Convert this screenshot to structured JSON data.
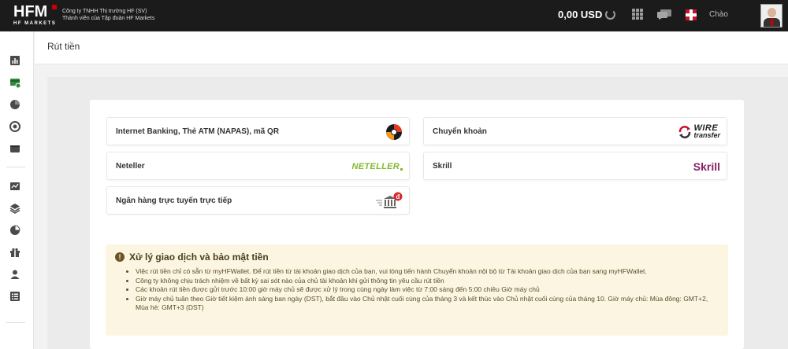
{
  "header": {
    "logo_text": "HFM",
    "logo_sub": "HF MARKETS",
    "company_line1": "Công ty TNHH Thị trường HF (SV)",
    "company_line2": "Thành viên của Tập đoàn HF Markets",
    "balance": "0,00 USD",
    "language_label": "Chào"
  },
  "page": {
    "title": "Rút tiền"
  },
  "methods": [
    {
      "label": "Internet Banking, Thẻ ATM (NAPAS), mã QR",
      "logo": "napas-icon"
    },
    {
      "label": "Chuyển khoản",
      "logo": "wire-transfer-icon",
      "logo_text_1": "WIRE",
      "logo_text_2": "transfer"
    },
    {
      "label": "Neteller",
      "logo": "neteller-icon",
      "logo_text": "NETELLER"
    },
    {
      "label": "Skrill",
      "logo": "skrill-icon",
      "logo_text": "Skrill"
    },
    {
      "label": "Ngân hàng trực tuyến trực tiếp",
      "logo": "bank-icon",
      "badge": "đ"
    }
  ],
  "notice": {
    "title": "Xử lý giao dịch và bảo mật tiền",
    "items": [
      "Việc rút tiền chỉ có sẵn từ myHFWallet. Để rút tiền từ tài khoản giao dịch của bạn, vui lòng tiến hành Chuyển khoản nội bộ từ Tài khoản giao dịch của bạn sang myHFWallet.",
      "Công ty không chịu trách nhiệm về bất kỳ sai sót nào của chủ tài khoản khi gửi thông tin yêu cầu rút tiền",
      "Các khoản rút tiền được gửi trước 10:00 giờ máy chủ sẽ được xử lý trong cùng ngày làm việc từ 7:00 sáng đến 5:00 chiều Giờ máy chủ",
      "Giờ máy chủ tuân theo Giờ tiết kiệm ánh sáng ban ngày (DST), bắt đầu vào Chủ nhật cuối cùng của tháng 3 và kết thúc vào Chủ nhật cuối cùng của tháng 10. Giờ máy chủ: Mùa đông: GMT+2, Mùa hè: GMT+3 (DST)"
    ]
  },
  "colors": {
    "topbar": "#1b1b1b",
    "accent_green": "#2e8b3a",
    "neteller_green": "#83b92e",
    "skrill_purple": "#862165",
    "notice_bg": "#fcf5e1"
  }
}
